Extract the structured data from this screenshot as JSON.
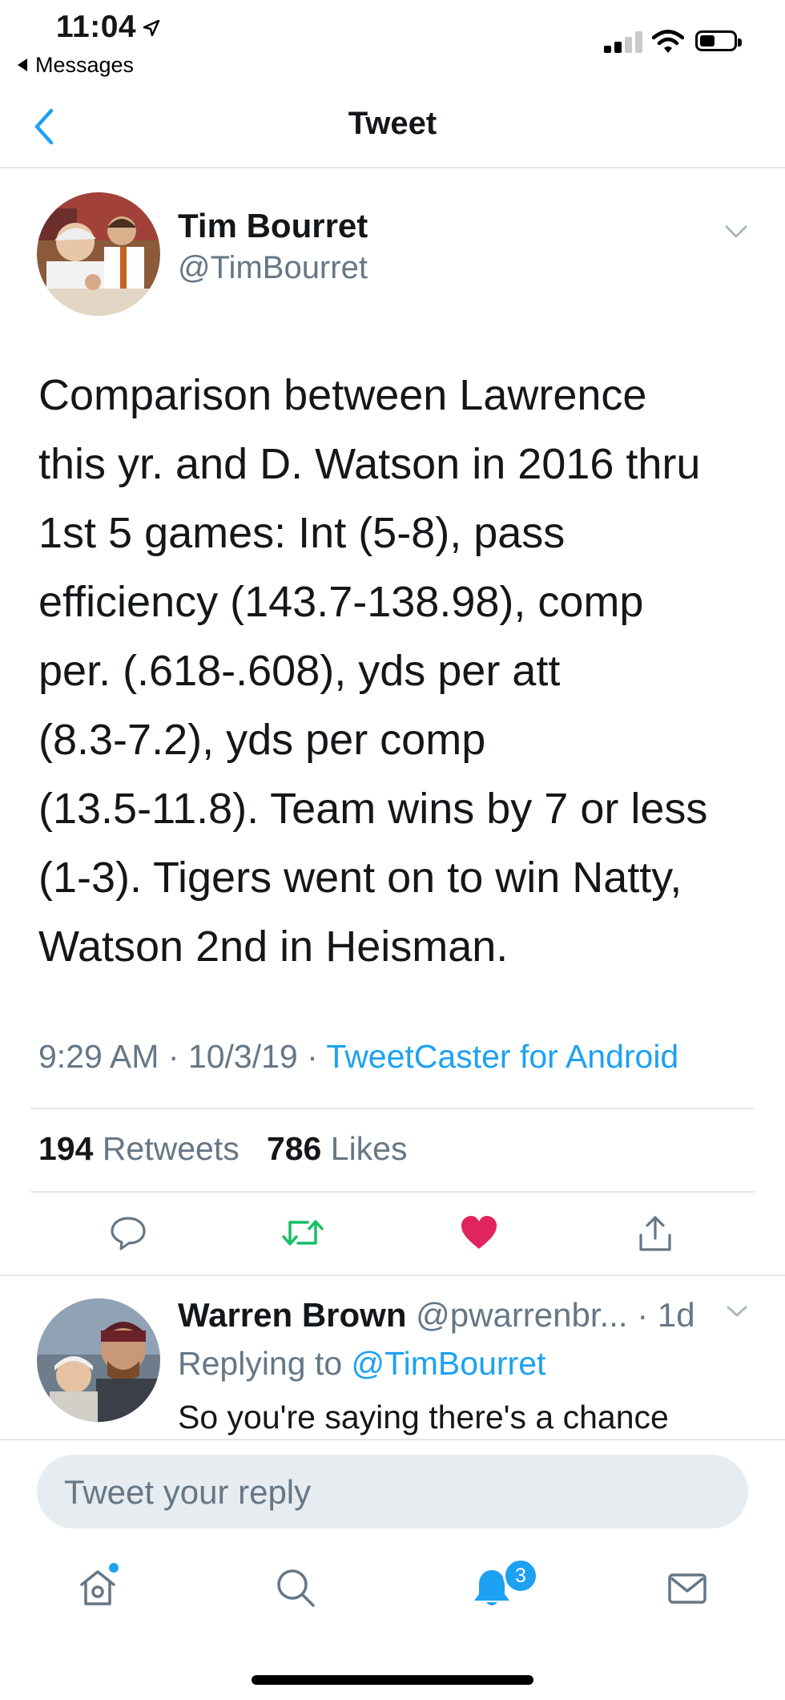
{
  "status_bar": {
    "time": "11:04",
    "back_app": "Messages"
  },
  "nav": {
    "title": "Tweet"
  },
  "tweet": {
    "author_name": "Tim Bourret",
    "author_handle": "@TimBourret",
    "text": "Comparison between Lawrence\nthis yr. and D. Watson in 2016 thru\n1st 5 games: Int (5-8), pass\nefficiency (143.7-138.98), comp\nper. (.618-.608), yds per att\n(8.3-7.2),  yds per comp\n(13.5-11.8). Team wins by 7 or less\n(1-3). Tigers went on to win Natty,\nWatson 2nd in Heisman.",
    "time": "9:29 AM",
    "date": "10/3/19",
    "source": "TweetCaster for Android",
    "retweets_count": "194",
    "retweets_label": "Retweets",
    "likes_count": "786",
    "likes_label": "Likes"
  },
  "actions": {
    "icons": [
      "reply-icon",
      "retweet-icon",
      "like-icon",
      "share-icon"
    ],
    "retweet_color": "#17bf63",
    "like_color": "#e0245e"
  },
  "reply": {
    "name": "Warren Brown",
    "handle": "@pwarrenbr...",
    "age": "1d",
    "replying_prefix": "Replying to",
    "replying_to": "@TimBourret",
    "text": "So you're saying there's a chance"
  },
  "composer": {
    "placeholder": "Tweet your reply"
  },
  "tab_bar": {
    "items": [
      "home-icon",
      "search-icon",
      "notifications-icon",
      "messages-icon"
    ],
    "notifications_badge": "3"
  },
  "colors": {
    "accent": "#1da1f2",
    "secondary_text": "#657786",
    "divider": "#e1e8ed"
  }
}
